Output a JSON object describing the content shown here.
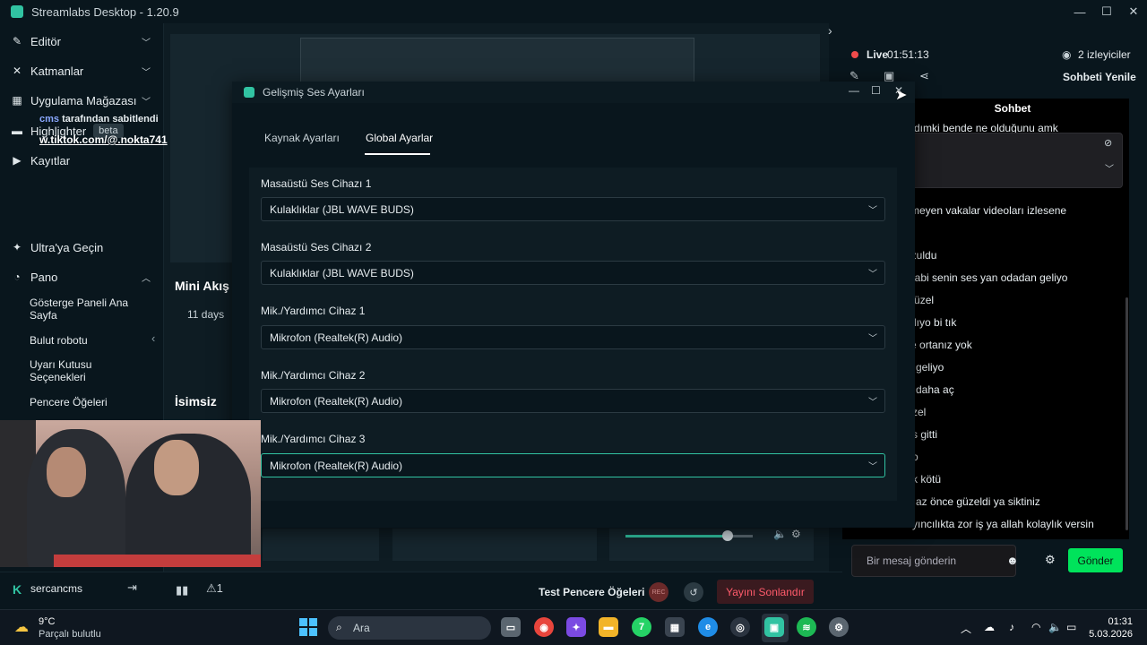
{
  "window": {
    "title": "Streamlabs Desktop - 1.20.9",
    "controls": {
      "minimize": "—",
      "maximize": "☐",
      "close": "✕"
    }
  },
  "sidebar": {
    "items": [
      {
        "label": "Editör",
        "icon": "pencil-icon"
      },
      {
        "label": "Katmanlar",
        "icon": "layers-icon"
      },
      {
        "label": "Uygulama Mağazası",
        "icon": "store-icon"
      },
      {
        "label": "Highlighter",
        "icon": "highlighter-icon",
        "badge": "beta"
      },
      {
        "label": "Kayıtlar",
        "icon": "play-icon"
      },
      {
        "label": "Ultra'ya Geçin",
        "icon": "ultra-icon"
      },
      {
        "label": "Pano",
        "icon": "dashboard-icon"
      }
    ],
    "sub_items": [
      "Gösterge Paneli Ana Sayfa",
      "Bulut robotu",
      "Uyarı Kutusu Seçenekleri",
      "Pencere Öğeleri"
    ],
    "user": {
      "logo": "K",
      "name": "sercancms"
    }
  },
  "center": {
    "mini_akis": "Mini Akış",
    "days": "11 days",
    "isimsiz": "İsimsiz",
    "volume_level": 0.8
  },
  "bottombar": {
    "test_widgets": "Test Pencere Öğeleri",
    "rec": "REC",
    "end_stream": "Yayını Sonlandır",
    "alert_count": "1"
  },
  "chat": {
    "live_label": "Live",
    "live_time": "01:51:13",
    "viewers": "2 izleyiciler",
    "refresh": "Sohbeti Yenile",
    "header": "Sohbet",
    "pinned_by_user": "cms",
    "pinned_by_text": "tarafından sabitlendi",
    "pinned_link": "w.tiktok.com/@.nokta741",
    "messages": [
      "lamadımki bende ne olduğunu amk",
      "l",
      "zülemeyen vakalar videoları izlesene",
      "et",
      "s bozuldu",
      "rcan abi senin ses yan odadan geliyo",
      "ndi güzel",
      "s patlıyo bi tık",
      "kinde ortanız yok",
      "geliyo",
      "daha aç",
      "zel",
      "s gitti",
      "o",
      "k kötü",
      "n az önce güzeldi ya siktiniz",
      "yıncılıkta zor iş ya allah kolaylık versin"
    ],
    "input_placeholder": "Bir mesaj gönderin",
    "send": "Gönder"
  },
  "dialog": {
    "title": "Gelişmiş Ses Ayarları",
    "tabs": [
      "Kaynak Ayarları",
      "Global Ayarlar"
    ],
    "active_tab": "Global Ayarlar",
    "fields": [
      {
        "label": "Masaüstü Ses Cihazı 1",
        "value": "Kulaklıklar (JBL WAVE BUDS)"
      },
      {
        "label": "Masaüstü Ses Cihazı 2",
        "value": "Kulaklıklar (JBL WAVE BUDS)"
      },
      {
        "label": "Mik./Yardımcı Cihaz 1",
        "value": "Mikrofon (Realtek(R) Audio)"
      },
      {
        "label": "Mik./Yardımcı Cihaz 2",
        "value": "Mikrofon (Realtek(R) Audio)"
      },
      {
        "label": "Mik./Yardımcı Cihaz 3",
        "value": "Mikrofon (Realtek(R) Audio)"
      }
    ]
  },
  "taskbar": {
    "temp": "9°C",
    "condition": "Parçalı bulutlu",
    "search_placeholder": "Ara",
    "time": "01:31",
    "date": "5.03.2026",
    "whatsapp_badge": "7"
  },
  "colors": {
    "accent": "#31c3a2",
    "danger": "#ff5b6b",
    "send": "#00e35b"
  }
}
